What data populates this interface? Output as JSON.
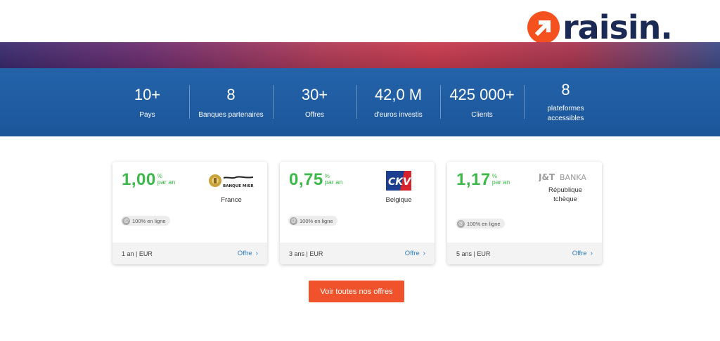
{
  "logo": {
    "text": "raisin."
  },
  "stats": [
    {
      "value": "10+",
      "label": "Pays"
    },
    {
      "value": "8",
      "label": "Banques partenaires"
    },
    {
      "value": "30+",
      "label": "Offres"
    },
    {
      "value": "42,0 M",
      "label": "d'euros investis"
    },
    {
      "value": "425 000+",
      "label": "Clients"
    },
    {
      "value": "8",
      "label": "plateformes accessibles"
    }
  ],
  "offers": [
    {
      "rate": "1,00",
      "percent": "%",
      "per_year": "par an",
      "bank_logo_text": "Banque Misr",
      "bank_logo_arabic": "بنك مصر",
      "country": "France",
      "badge": "100% en ligne",
      "term": "1 an | EUR",
      "link": "Offre"
    },
    {
      "rate": "0,75",
      "percent": "%",
      "per_year": "par an",
      "bank_logo_text": "CKV",
      "country": "Belgique",
      "badge": "100% en ligne",
      "term": "3 ans | EUR",
      "link": "Offre"
    },
    {
      "rate": "1,17",
      "percent": "%",
      "per_year": "par an",
      "bank_logo_text": "J&T BANKA",
      "country": "République tchèque",
      "badge": "100% en ligne",
      "term": "5 ans | EUR",
      "link": "Offre"
    }
  ],
  "cta": {
    "label": "Voir toutes nos offres"
  },
  "colors": {
    "brand_orange": "#f4511e",
    "brand_navy": "#1b2a55",
    "band_blue": "#2463a9",
    "rate_green": "#3cb94a",
    "link_blue": "#2f7cc1",
    "cta_orange": "#f0522b"
  },
  "icons": {
    "logo_mark": "arrow-up-right-icon",
    "badge": "globe-icon",
    "link": "chevron-right-icon"
  }
}
